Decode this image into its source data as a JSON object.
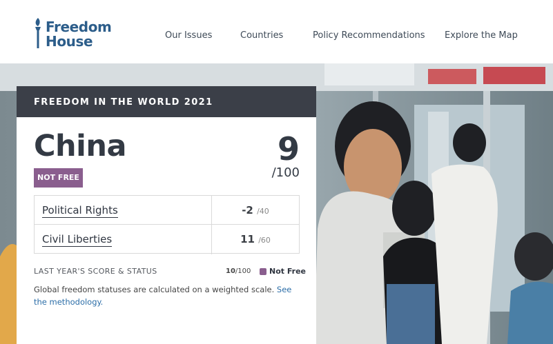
{
  "brand": {
    "name_line1": "Freedom",
    "name_line2": "House",
    "color": "#2c5d8a"
  },
  "nav": [
    {
      "label": "Our Issues"
    },
    {
      "label": "Countries"
    },
    {
      "label": "Policy Recommendations"
    },
    {
      "label": "Explore the Map"
    }
  ],
  "report": {
    "title": "FREEDOM IN THE WORLD 2021",
    "country": "China",
    "status": "NOT FREE",
    "status_color": "#8a5e8e",
    "score": "9",
    "score_max": "/100",
    "categories": [
      {
        "label": "Political Rights",
        "score": "-2",
        "max": "/40"
      },
      {
        "label": "Civil Liberties",
        "score": "11",
        "max": "/60"
      }
    ],
    "last_year_label": "LAST YEAR'S SCORE & STATUS",
    "last_year_score": "10",
    "last_year_max": "/100",
    "last_year_status": "Not Free",
    "note_text": "Global freedom statuses are calculated on a weighted scale. ",
    "note_link": "See the methodology."
  }
}
